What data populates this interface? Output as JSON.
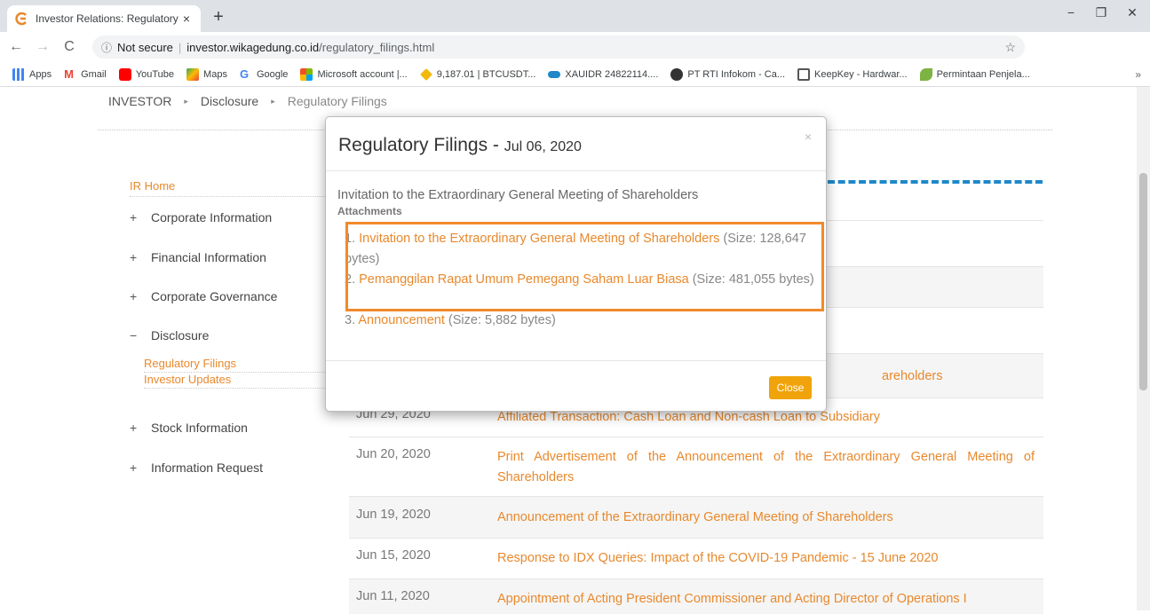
{
  "browser": {
    "tab_title": "Investor Relations: Regulatory Fil",
    "tab_close": "×",
    "new_tab": "+",
    "security": "Not secure",
    "url_host": "investor.wikagedung.co.id",
    "url_path": "/regulatory_filings.html",
    "win_min": "−",
    "win_max": "❐",
    "win_close": "✕",
    "bookmarks": [
      {
        "label": "Apps",
        "color": "#4285f4"
      },
      {
        "label": "Gmail",
        "color": "#ea4335"
      },
      {
        "label": "YouTube",
        "color": "#ff0000"
      },
      {
        "label": "Maps",
        "color": "#34a853"
      },
      {
        "label": "Google",
        "color": "#4285f4"
      },
      {
        "label": "Microsoft account |...",
        "color": "#f25022"
      },
      {
        "label": "9,187.01 | BTCUSDT...",
        "color": "#f0b90b"
      },
      {
        "label": "XAUIDR 24822114....",
        "color": "#1e88c8"
      },
      {
        "label": "PT RTI Infokom - Ca...",
        "color": "#333333"
      },
      {
        "label": "KeepKey - Hardwar...",
        "color": "#555555"
      },
      {
        "label": "Permintaan Penjela...",
        "color": "#7cb342"
      }
    ],
    "bookmarks_more": "»"
  },
  "breadcrumb": {
    "items": [
      "INVESTOR",
      "Disclosure"
    ],
    "current": "Regulatory Filings",
    "sep": "▸"
  },
  "sidebar": {
    "home": "IR Home",
    "items": [
      {
        "icon": "+",
        "label": "Corporate Information"
      },
      {
        "icon": "+",
        "label": "Financial Information"
      },
      {
        "icon": "+",
        "label": "Corporate Governance"
      },
      {
        "icon": "−",
        "label": "Disclosure"
      },
      {
        "icon": "+",
        "label": "Stock Information"
      },
      {
        "icon": "+",
        "label": "Information Request"
      }
    ],
    "sub": [
      "Regulatory Filings",
      "Investor Updates"
    ]
  },
  "table": {
    "rows": [
      {
        "date": "",
        "title": "areholders"
      },
      {
        "date": "Jun 29, 2020",
        "title": "Affiliated Transaction: Cash Loan and Non-cash Loan to Subsidiary"
      },
      {
        "date": "Jun 20, 2020",
        "title": "Print Advertisement of the Announcement of the Extraordinary General Meeting of Shareholders"
      },
      {
        "date": "Jun 19, 2020",
        "title": "Announcement of the Extraordinary General Meeting of Shareholders"
      },
      {
        "date": "Jun 15, 2020",
        "title": "Response to IDX Queries: Impact of the COVID-19 Pandemic - 15 June 2020"
      },
      {
        "date": "Jun 11, 2020",
        "title": "Appointment of Acting President Commissioner and Acting Director of Operations I"
      }
    ]
  },
  "modal": {
    "title": "Regulatory Filings - ",
    "date": "Jul 06, 2020",
    "close_x": "×",
    "description": "Invitation to the Extraordinary General Meeting of Shareholders",
    "attachments_label": "Attachments",
    "attachments": [
      {
        "num": "1. ",
        "name": "Invitation to the Extraordinary General Meeting of Shareholders",
        "size": " (Size: 128,647 bytes)"
      },
      {
        "num": "2. ",
        "name": "Pemanggilan Rapat Umum Pemegang Saham Luar Biasa",
        "size": " (Size: 481,055 bytes)"
      },
      {
        "num": "3. ",
        "name": "Announcement",
        "size": " (Size: 5,882 bytes)"
      }
    ],
    "close_button": "Close"
  }
}
